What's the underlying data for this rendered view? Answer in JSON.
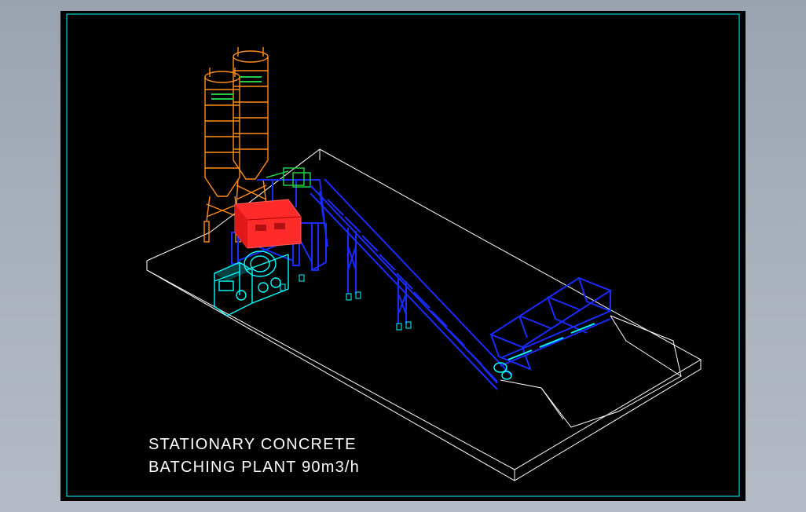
{
  "drawing": {
    "title_line_1": "STATIONARY CONCRETE",
    "title_line_2": "BATCHING PLANT 90m3/h"
  },
  "colors": {
    "background_gray": "#a9b1bd",
    "viewport": "#000000",
    "frame": "#00ffff",
    "silo": "#ff8c1a",
    "structure": "#1a2bff",
    "cabin": "#ff2a2a",
    "mixer_truck": "#00ffff",
    "equipment": "#22cc44",
    "platform": "#ffffff"
  }
}
